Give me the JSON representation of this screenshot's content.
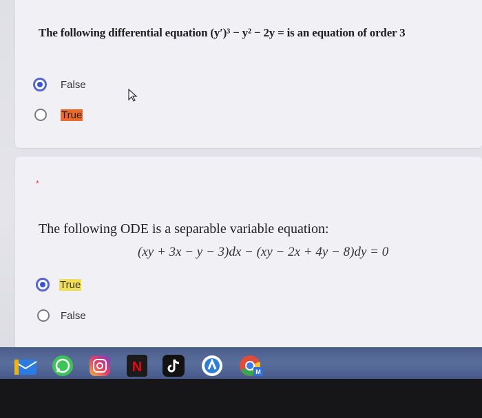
{
  "question1": {
    "text": "The following differential equation (y′)³ − y² − 2y = is an equation of order 3",
    "options": [
      {
        "label": "False",
        "selected": true
      },
      {
        "label": "True",
        "selected": false,
        "highlight": "#e96a2a"
      }
    ]
  },
  "question2": {
    "required_marker": "*",
    "text": "The following ODE is a separable variable equation:",
    "equation": "(xy + 3x − y − 3)dx − (xy − 2x + 4y − 8)dy = 0",
    "options": [
      {
        "label": "True",
        "selected": true,
        "highlight": "#f1df53"
      },
      {
        "label": "False",
        "selected": false
      }
    ]
  },
  "colors": {
    "accent": "#3a55d8",
    "taskbar": "#4a5d8a"
  },
  "taskbar": {
    "icons": [
      "mail-icon",
      "whatsapp-icon",
      "instagram-icon",
      "netflix-icon",
      "tiktok-icon",
      "app-icon",
      "chrome-icon"
    ],
    "netflix_letter": "N",
    "chrome_badge": "M"
  }
}
